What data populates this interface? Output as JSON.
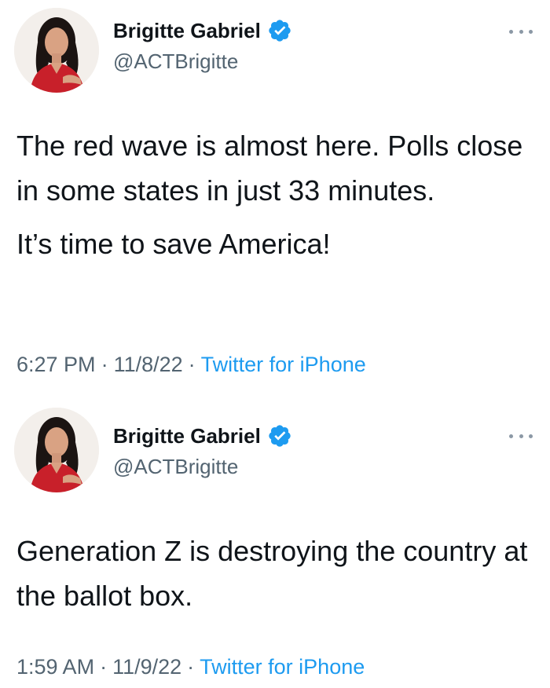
{
  "tweets": [
    {
      "display_name": "Brigitte Gabriel",
      "handle": "@ACTBrigitte",
      "verified": true,
      "paragraphs": [
        "The red wave is almost here. Polls close in some states in just 33 minutes.",
        "It’s time to save America!"
      ],
      "time": "6:27 PM",
      "date": "11/8/22",
      "separator": "·",
      "source": "Twitter for iPhone"
    },
    {
      "display_name": "Brigitte Gabriel",
      "handle": "@ACTBrigitte",
      "verified": true,
      "paragraphs": [
        "Generation Z is destroying the country at the ballot box."
      ],
      "time": "1:59 AM",
      "date": "11/9/22",
      "separator": "·",
      "source": "Twitter for iPhone"
    }
  ],
  "icons": {
    "verified": "verified-badge-icon",
    "more": "more-options-icon"
  },
  "colors": {
    "text_primary": "#0f1419",
    "text_secondary": "#536471",
    "link_blue": "#1d9bf0",
    "verified_blue": "#1d9bf0",
    "background": "#ffffff"
  }
}
